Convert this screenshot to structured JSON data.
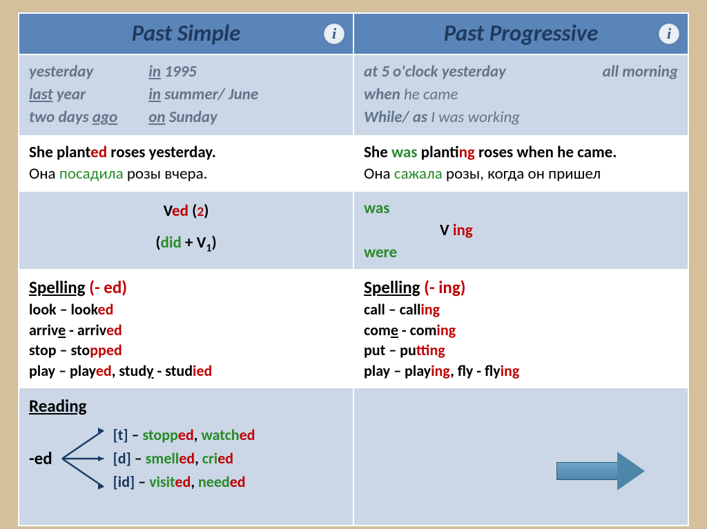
{
  "headers": {
    "left": "Past Simple",
    "right": "Past Progressive"
  },
  "markers": {
    "left": {
      "col1": {
        "a": "yesterday",
        "b_pre": "last",
        "b_u": " year",
        "c_pre": "two days ",
        "c_u": "ago"
      },
      "col2": {
        "a_pre": "in",
        "a_rest": " 1995",
        "b_pre": "in",
        "b_rest": " summer/ June",
        "c_pre": "on",
        "c_rest": " Sunday"
      }
    },
    "right": {
      "l1a": "at 5 o'clock  yesterday",
      "l1b": "all morning",
      "l2_pre": "when ",
      "l2_rest": "he came",
      "l3_pre": "While/ as ",
      "l3_rest": "I was working"
    }
  },
  "example": {
    "left": {
      "en_a": "She  plant",
      "en_ed": "ed",
      "en_b": " roses yesterday.",
      "ru_a": "Она ",
      "ru_green": "посадила",
      "ru_b": " розы вчера."
    },
    "right": {
      "en_a": "She ",
      "en_was": "was",
      "en_b": " plant",
      "en_ing": "ing",
      "en_c": " roses when he came.",
      "ru_a": "Она ",
      "ru_green": "сажала",
      "ru_b": " розы, когда он пришел"
    }
  },
  "formula": {
    "left": {
      "l1_v": "V",
      "l1_ed": "ed",
      "l1_p": " (",
      "l1_two": "2",
      "l1_close": ")",
      "l2_open": "(",
      "l2_did": "did",
      "l2_plus": " + V",
      "l2_one": "1",
      "l2_close": ")"
    },
    "right": {
      "was": "was",
      "v": "V ",
      "ing": "ing",
      "were": "were"
    }
  },
  "spelling": {
    "left": {
      "title": "Spelling",
      "suffix": "  (- ed)",
      "l1a": "look – look",
      "l1ed": "ed",
      "l2a": "arriv",
      "l2u": "e",
      "l2b": " - arriv",
      "l2ed": "ed",
      "l3a": "stop – sto",
      "l3pp": "pp",
      "l3ed": "ed",
      "l4a": "play – play",
      "l4ed": "ed",
      "l4b": ", stud",
      "l4y": "y",
      "l4c": " - stud",
      "l4i": "i",
      "l4ed2": "ed"
    },
    "right": {
      "title": "Spelling",
      "suffix": "  (- ing)",
      "l1a": "call – call",
      "l1ing": "ing",
      "l2a": "com",
      "l2u": "e",
      "l2b": " - com",
      "l2ing": "ing",
      "l3a": "put – pu",
      "l3tt": "tt",
      "l3ing": "ing",
      "l4a": "play – play",
      "l4ing": "ing",
      "l4b": ", fly - fly",
      "l4ing2": "ing"
    }
  },
  "reading": {
    "title": "Reading",
    "ed": "-ed",
    "row1": {
      "sound": "[t]",
      "sep": " – ",
      "w1a": "sto",
      "w1pp": "pp",
      "w1ed": "ed",
      "comma": ", ",
      "w2a": "watch",
      "w2ed": "ed"
    },
    "row2": {
      "sound": "[d]",
      "sep": " – ",
      "w1a": "smell",
      "w1ed": "ed",
      "comma": ", ",
      "w2a": "cri",
      "w2ed": "ed"
    },
    "row3": {
      "sound": "[id]",
      "sep": " – ",
      "w1a": "visit",
      "w1ed": "ed",
      "comma": ", ",
      "w2a": "need",
      "w2ed": "ed"
    }
  }
}
